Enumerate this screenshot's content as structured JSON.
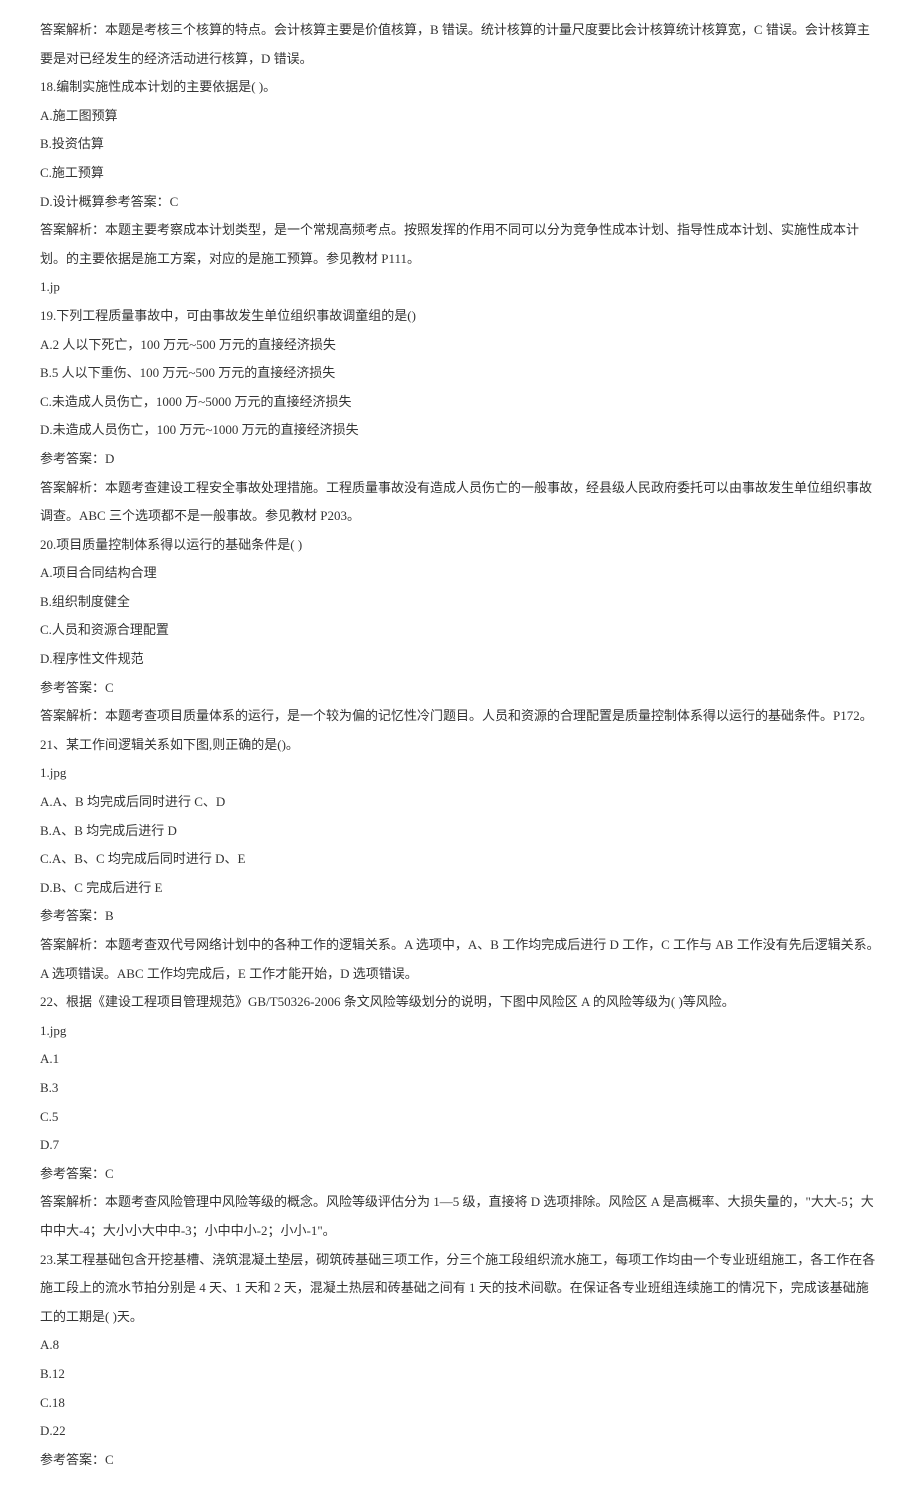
{
  "lines": [
    "答案解析：本题是考核三个核算的特点。会计核算主要是价值核算，B 错误。统计核算的计量尺度要比会计核算统计核算宽，C 错误。会计核算主要是对已经发生的经济活动进行核算，D 错误。",
    "18.编制实施性成本计划的主要依据是( )。",
    "A.施工图预算",
    "B.投资估算",
    "C.施工预算",
    "D.设计概算参考答案：C",
    "答案解析：本题主要考察成本计划类型，是一个常规高频考点。按照发挥的作用不同可以分为竞争性成本计划、指导性成本计划、实施性成本计划。的主要依据是施工方案，对应的是施工预算。参见教材 P111。",
    "1.jp",
    "19.下列工程质量事故中，可由事故发生单位组织事故调童组的是()",
    "A.2 人以下死亡，100 万元~500 万元的直接经济损失",
    "B.5 人以下重伤、100 万元~500 万元的直接经济损失",
    "C.未造成人员伤亡，1000 万~5000 万元的直接经济损失",
    "D.未造成人员伤亡，100 万元~1000 万元的直接经济损失",
    "参考答案：D",
    "答案解析：本题考查建设工程安全事故处理措施。工程质量事故没有造成人员伤亡的一般事故，经县级人民政府委托可以由事故发生单位组织事故调查。ABC 三个选项都不是一般事故。参见教材 P203。",
    "20.项目质量控制体系得以运行的基础条件是( )",
    "A.项目合同结构合理",
    "B.组织制度健全",
    "C.人员和资源合理配置",
    "D.程序性文件规范",
    "参考答案：C",
    "答案解析：本题考查项目质量体系的运行，是一个较为偏的记忆性冷门题目。人员和资源的合理配置是质量控制体系得以运行的基础条件。P172。",
    "21、某工作间逻辑关系如下图,则正确的是()。",
    "1.jpg",
    "A.A、B 均完成后同时进行 C、D",
    "B.A、B 均完成后进行 D",
    "C.A、B、C 均完成后同时进行 D、E",
    "D.B、C 完成后进行 E",
    "参考答案：B",
    "答案解析：本题考查双代号网络计划中的各种工作的逻辑关系。A 选项中，A、B 工作均完成后进行 D 工作，C 工作与 AB 工作没有先后逻辑关系。A 选项错误。ABC 工作均完成后，E 工作才能开始，D 选项错误。",
    "22、根据《建设工程项目管理规范》GB/T50326-2006 条文风险等级划分的说明，下图中风险区 A 的风险等级为( )等风险。",
    "1.jpg",
    "A.1",
    "B.3",
    "C.5",
    "D.7",
    "参考答案：C",
    "答案解析：本题考查风险管理中风险等级的概念。风险等级评估分为 1—5 级，直接将 D 选项排除。风险区 A 是高概率、大损失量的，\"大大-5；大中中大-4；大小小大中中-3；小中中小-2；小小-1\"。",
    "23.某工程基础包含开挖基槽、浇筑混凝土垫层，砌筑砖基础三项工作，分三个施工段组织流水施工，每项工作均由一个专业班组施工，各工作在各施工段上的流水节拍分别是 4 天、1 天和 2 天，混凝土热层和砖基础之间有 1 天的技术间歇。在保证各专业班组连续施工的情况下，完成该基础施工的工期是( )天。",
    "A.8",
    "B.12",
    "C.18",
    "D.22",
    "参考答案：C"
  ]
}
